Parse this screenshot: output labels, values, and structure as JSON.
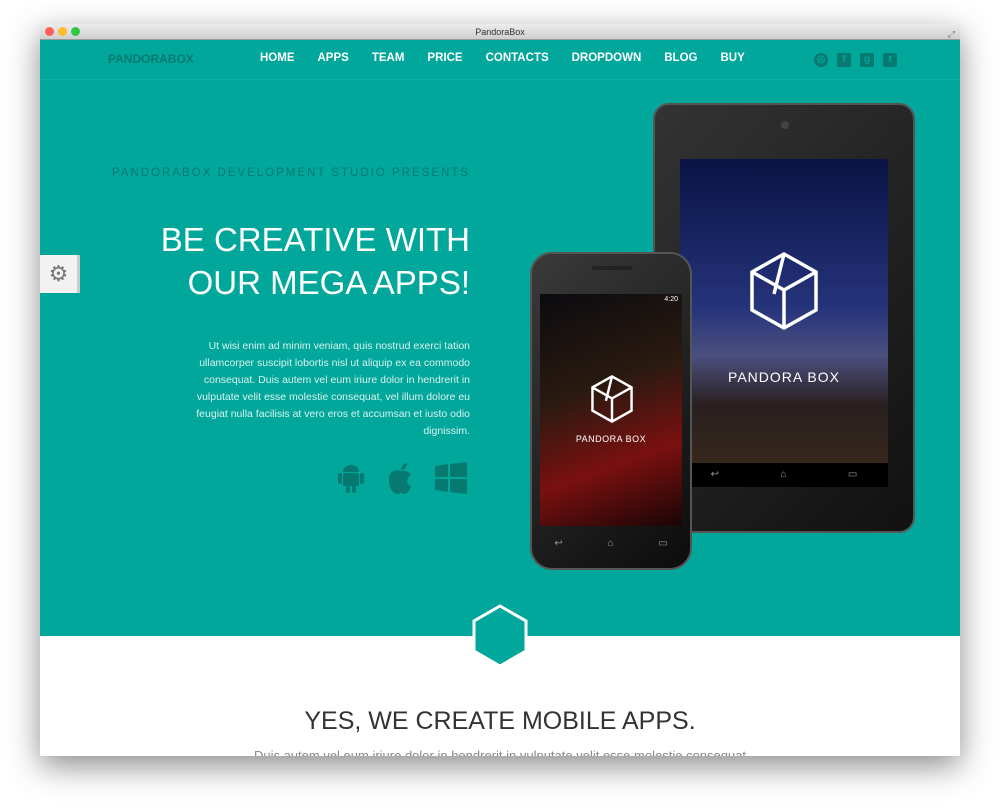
{
  "window": {
    "title": "PandoraBox"
  },
  "nav": {
    "logo": "PANDORABOX",
    "items": [
      "HOME",
      "APPS",
      "TEAM",
      "PRICE",
      "CONTACTS",
      "DROPDOWN",
      "BLOG",
      "BUY"
    ],
    "social": [
      "dribbble-icon",
      "facebook-icon",
      "google-plus-icon",
      "twitter-icon"
    ]
  },
  "hero": {
    "pretitle": "PANDORABOX DEVELOPMENT STUDIO PRESENTS",
    "title_line1": "BE CREATIVE WITH",
    "title_line2": "OUR MEGA APPS!",
    "description": "Ut wisi enim ad minim veniam, quis nostrud exerci tation ullamcorper suscipit lobortis nisl ut aliquip ex ea commodo consequat. Duis autem vel eum iriure dolor in hendrerit in vulputate velit esse molestie consequat, vel illum dolore eu feugiat nulla facilisis at vero eros et accumsan et iusto odio dignissim.",
    "platforms": [
      "android-icon",
      "apple-icon",
      "windows-icon"
    ],
    "tablet_label": "PANDORA BOX",
    "phone_label": "PANDORA BOX",
    "phone_time": "4:20"
  },
  "section": {
    "title": "YES, WE CREATE MOBILE APPS.",
    "subtitle": "Duis autem vel eum iriure dolor in hendrerit in vulputate velit esse molestie consequat"
  },
  "colors": {
    "teal": "#00a79a",
    "dark_teal": "#067a70"
  }
}
